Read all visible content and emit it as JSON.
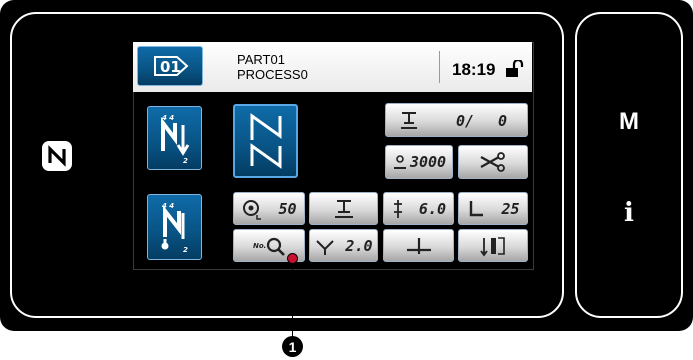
{
  "header": {
    "part": "PART01",
    "process": "PROCESS0",
    "time": "18:19",
    "sequence_label": "01"
  },
  "side_keys": {
    "menu": "M",
    "info": "i"
  },
  "counters": {
    "count": "0/",
    "count2": "0",
    "speed": "3000"
  },
  "params": {
    "thread_tension": "50",
    "stitch_length": "6.0",
    "foot_value": "25",
    "needle_value": "2.0"
  },
  "callout": {
    "number": "1"
  },
  "colors": {
    "blue_button": "#085384",
    "callout_dot": "#c8102e"
  }
}
